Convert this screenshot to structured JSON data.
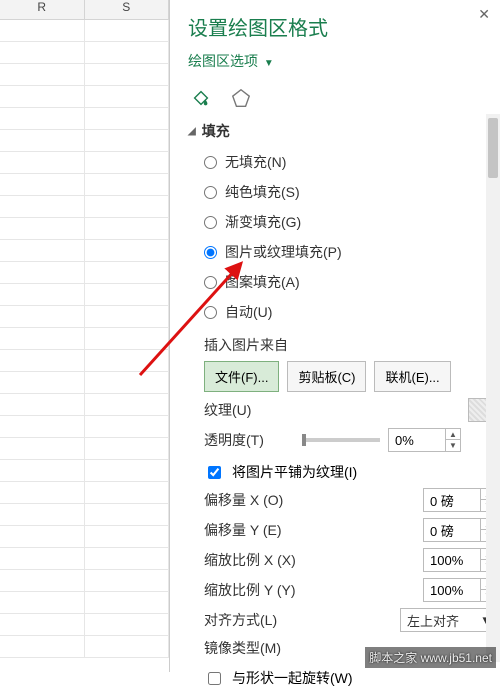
{
  "sheet": {
    "columns": [
      "R",
      "S"
    ]
  },
  "pane": {
    "title": "设置绘图区格式",
    "options_link": "绘图区选项",
    "section_fill": "填充",
    "radios": {
      "none": "无填充(N)",
      "solid": "纯色填充(S)",
      "gradient": "渐变填充(G)",
      "picture": "图片或纹理填充(P)",
      "pattern": "图案填充(A)",
      "auto": "自动(U)"
    },
    "insert_from": "插入图片来自",
    "btn_file": "文件(F)...",
    "btn_clip": "剪贴板(C)",
    "btn_online": "联机(E)...",
    "texture_label": "纹理(U)",
    "transparency_label": "透明度(T)",
    "transparency_value": "0%",
    "tile_label": "将图片平铺为纹理(I)",
    "offset_x_label": "偏移量 X (O)",
    "offset_x_value": "0 磅",
    "offset_y_label": "偏移量 Y (E)",
    "offset_y_value": "0 磅",
    "scale_x_label": "缩放比例 X (X)",
    "scale_x_value": "100%",
    "scale_y_label": "缩放比例 Y (Y)",
    "scale_y_value": "100%",
    "align_label": "对齐方式(L)",
    "align_value": "左上对齐",
    "mirror_label": "镜像类型(M)",
    "rotate_label": "与形状一起旋转(W)"
  },
  "watermark": "脚本之家 www.jb51.net"
}
